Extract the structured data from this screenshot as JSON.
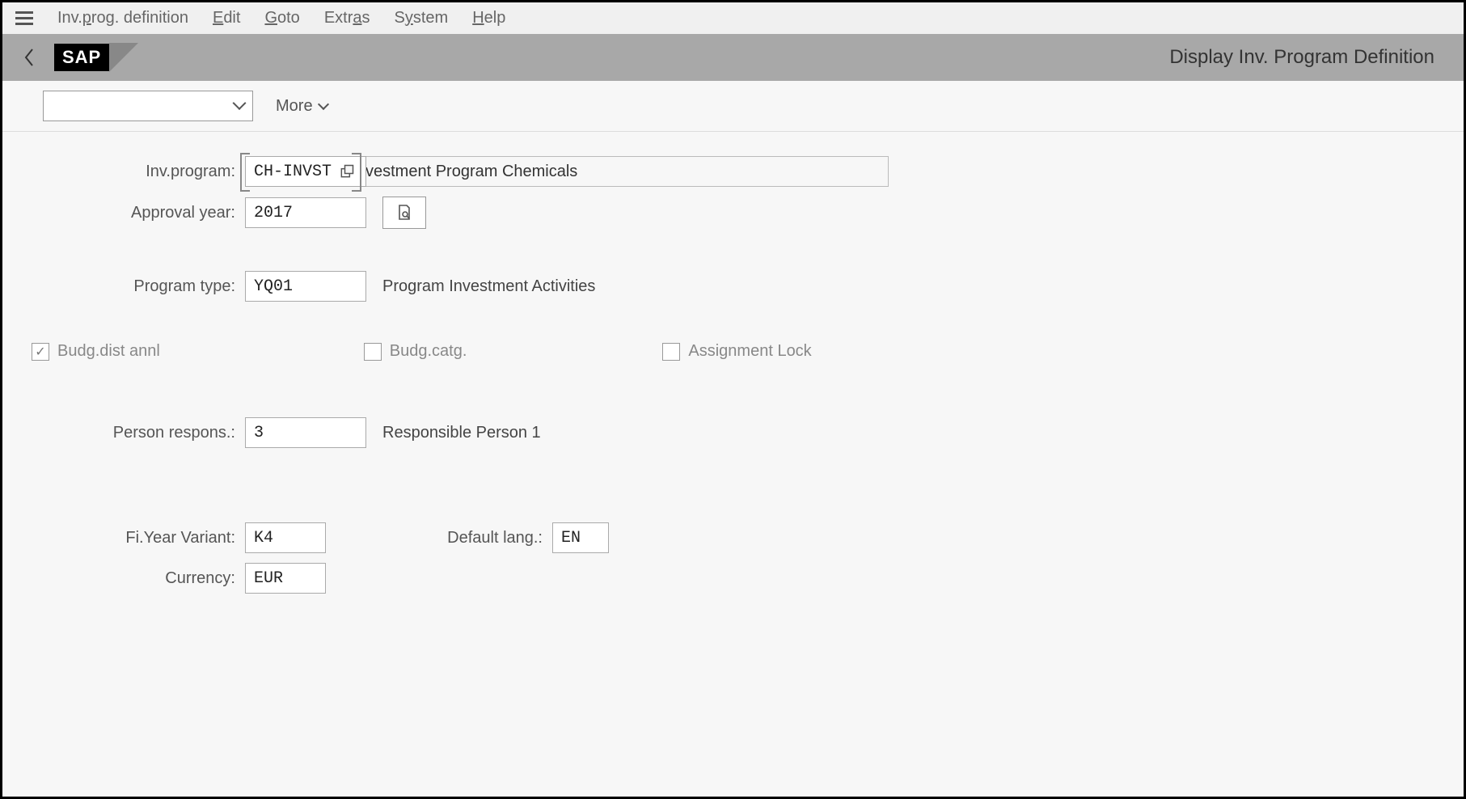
{
  "menubar": {
    "items": [
      {
        "prefix": "Inv.",
        "ul": "p",
        "suffix": "rog. definition"
      },
      {
        "prefix": "",
        "ul": "E",
        "suffix": "dit"
      },
      {
        "prefix": "",
        "ul": "G",
        "suffix": "oto"
      },
      {
        "prefix": "Extr",
        "ul": "a",
        "suffix": "s"
      },
      {
        "prefix": "S",
        "ul": "y",
        "suffix": "stem"
      },
      {
        "prefix": "",
        "ul": "H",
        "suffix": "elp"
      }
    ]
  },
  "titlebar": {
    "logo_text": "SAP",
    "page_title": "Display Inv. Program Definition"
  },
  "toolbar": {
    "dropdown_value": "",
    "more_label": "More"
  },
  "form": {
    "inv_program": {
      "label": "Inv.program:",
      "value": "CH-INVST",
      "description": "vestment Program Chemicals"
    },
    "approval_year": {
      "label": "Approval year:",
      "value": "2017"
    },
    "program_type": {
      "label": "Program type:",
      "value": "YQ01",
      "description": "Program Investment Activities"
    },
    "checkboxes": {
      "budg_dist_annl": {
        "label": "Budg.dist annl",
        "checked": true
      },
      "budg_catg": {
        "label": "Budg.catg.",
        "checked": false
      },
      "assignment_lock": {
        "label": "Assignment Lock",
        "checked": false
      }
    },
    "person_respons": {
      "label": "Person respons.:",
      "value": "3",
      "description": "Responsible Person 1"
    },
    "fi_year_variant": {
      "label": "Fi.Year Variant:",
      "value": "K4"
    },
    "default_lang": {
      "label": "Default lang.:",
      "value": "EN"
    },
    "currency": {
      "label": "Currency:",
      "value": "EUR"
    }
  }
}
